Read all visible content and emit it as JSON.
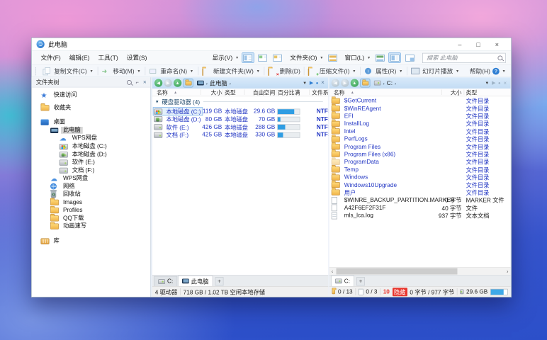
{
  "window": {
    "title": "此电脑",
    "controls": {
      "minimize": "–",
      "maximize": "□",
      "close": "×"
    }
  },
  "menubar": {
    "items": [
      {
        "label": "文件(F)"
      },
      {
        "label": "编辑(E)"
      },
      {
        "label": "工具(T)"
      },
      {
        "label": "设置(S)"
      }
    ],
    "view_group_label": "显示(V)",
    "folder_group_label": "文件夹(O)",
    "window_group_label": "窗口(L)",
    "search_placeholder": "搜索 此电脑"
  },
  "toolbar": {
    "items": [
      {
        "label": "复制文件(C)",
        "dropdown": true
      },
      {
        "label": "移动(M)",
        "dropdown": true
      },
      {
        "label": "重命名(N)",
        "dropdown": true
      },
      {
        "label": "新建文件夹(W)",
        "dropdown": true
      },
      {
        "label": "删除(D)",
        "dropdown": false
      },
      {
        "label": "压缩文件(I)",
        "dropdown": true
      },
      {
        "label": "属性(R)",
        "dropdown": true
      },
      {
        "label": "幻灯片播放",
        "dropdown": true
      }
    ],
    "help_label": "帮助(H)"
  },
  "tree": {
    "header": "文件夹树",
    "items": [
      {
        "label": "快速访问",
        "level": 1,
        "icon": "star",
        "gap": 3
      },
      {
        "label": "收藏夹",
        "level": 1,
        "icon": "folder",
        "gap": 9
      },
      {
        "label": "桌面",
        "level": 1,
        "icon": "desktop",
        "gap": 12
      },
      {
        "label": "此电脑",
        "level": 2,
        "icon": "computer",
        "selected": true
      },
      {
        "label": "WPS网盘",
        "level": 3,
        "icon": "cloud"
      },
      {
        "label": "本地磁盘 (C:)",
        "level": 3,
        "icon": "drive-c"
      },
      {
        "label": "本地磁盘 (D:)",
        "level": 3,
        "icon": "drive-d"
      },
      {
        "label": "软件 (E:)",
        "level": 3,
        "icon": "drive"
      },
      {
        "label": "文档 (F:)",
        "level": 3,
        "icon": "drive"
      },
      {
        "label": "WPS网盘",
        "level": 2,
        "icon": "cloud"
      },
      {
        "label": "网络",
        "level": 2,
        "icon": "network"
      },
      {
        "label": "回收站",
        "level": 2,
        "icon": "recycle"
      },
      {
        "label": "Images",
        "level": 2,
        "icon": "folder"
      },
      {
        "label": "Profiles",
        "level": 2,
        "icon": "folder"
      },
      {
        "label": "QQ下载",
        "level": 2,
        "icon": "folder"
      },
      {
        "label": "动画速写",
        "level": 2,
        "icon": "folder"
      },
      {
        "label": "库",
        "level": 1,
        "icon": "library",
        "gap": 12
      }
    ]
  },
  "middle_pane": {
    "breadcrumb": {
      "root_icon": "computer",
      "segments": [
        "此电脑"
      ]
    },
    "columns": {
      "name": "名称",
      "size": "大小",
      "type": "类型",
      "free": "自由空间",
      "percent": "百分比满",
      "fs": "文件系统"
    },
    "group_label": "硬盘驱动器 (4)",
    "drives": [
      {
        "name": "本地磁盘 (C:)",
        "icon": "drive-c",
        "size": "119 GB",
        "type": "本地磁盘",
        "free": "29.6 GB",
        "percent_full": 75,
        "fs": "NTFS",
        "selected": true
      },
      {
        "name": "本地磁盘 (D:)",
        "icon": "drive-d",
        "size": "80 GB",
        "type": "本地磁盘",
        "free": "70 GB",
        "percent_full": 12,
        "fs": "NTFS",
        "selected": false
      },
      {
        "name": "软件 (E:)",
        "icon": "drive",
        "size": "426 GB",
        "type": "本地磁盘",
        "free": "288 GB",
        "percent_full": 33,
        "fs": "NTFS",
        "selected": false
      },
      {
        "name": "文档 (F:)",
        "icon": "drive",
        "size": "425 GB",
        "type": "本地磁盘",
        "free": "330 GB",
        "percent_full": 25,
        "fs": "NTFS",
        "selected": false
      }
    ],
    "tabs": [
      {
        "label": "C:",
        "icon": "drive",
        "active": false
      },
      {
        "label": "此电脑",
        "icon": "computer",
        "active": true
      }
    ],
    "new_tab_label": "+",
    "status": {
      "drives_count": "4 驱动器",
      "storage": "718 GB / 1.02 TB 空闲本地存储"
    }
  },
  "right_pane": {
    "breadcrumb": {
      "root_icon": "drive",
      "segments": [
        "C:"
      ]
    },
    "columns": {
      "name": "名称",
      "size": "大小",
      "type": "类型"
    },
    "items": [
      {
        "name": "$GetCurrent",
        "size": "",
        "type": "文件目录",
        "kind": "folder"
      },
      {
        "name": "$WinREAgent",
        "size": "",
        "type": "文件目录",
        "kind": "folder"
      },
      {
        "name": "EFI",
        "size": "",
        "type": "文件目录",
        "kind": "folder"
      },
      {
        "name": "InstallLog",
        "size": "",
        "type": "文件目录",
        "kind": "folder"
      },
      {
        "name": "Intel",
        "size": "",
        "type": "文件目录",
        "kind": "folder"
      },
      {
        "name": "PerfLogs",
        "size": "",
        "type": "文件目录",
        "kind": "folder"
      },
      {
        "name": "Program Files",
        "size": "",
        "type": "文件目录",
        "kind": "folder"
      },
      {
        "name": "Program Files (x86)",
        "size": "",
        "type": "文件目录",
        "kind": "folder"
      },
      {
        "name": "ProgramData",
        "size": "",
        "type": "文件目录",
        "kind": "folder-hidden"
      },
      {
        "name": "Temp",
        "size": "",
        "type": "文件目录",
        "kind": "folder"
      },
      {
        "name": "Windows",
        "size": "",
        "type": "文件目录",
        "kind": "folder"
      },
      {
        "name": "Windows10Upgrade",
        "size": "",
        "type": "文件目录",
        "kind": "folder"
      },
      {
        "name": "用户",
        "size": "",
        "type": "文件目录",
        "kind": "folder"
      },
      {
        "name": "$WINRE_BACKUP_PARTITION.MARKER",
        "size": "0 字节",
        "type": "MARKER 文件",
        "kind": "file"
      },
      {
        "name": "A42F6EF2F31F",
        "size": "40 字节",
        "type": "文件",
        "kind": "file"
      },
      {
        "name": "mls_lca.log",
        "size": "937 字节",
        "type": "文本文档",
        "kind": "file-log"
      }
    ],
    "tabs": [
      {
        "label": "C:",
        "icon": "drive",
        "active": true
      }
    ],
    "new_tab_label": "+",
    "status": {
      "folders": "0 / 13",
      "files": "0 / 3",
      "hidden_count": "10",
      "hidden_label": "隐藏",
      "bytes": "0 字节 / 977 字节",
      "free": "29.6 GB"
    }
  }
}
